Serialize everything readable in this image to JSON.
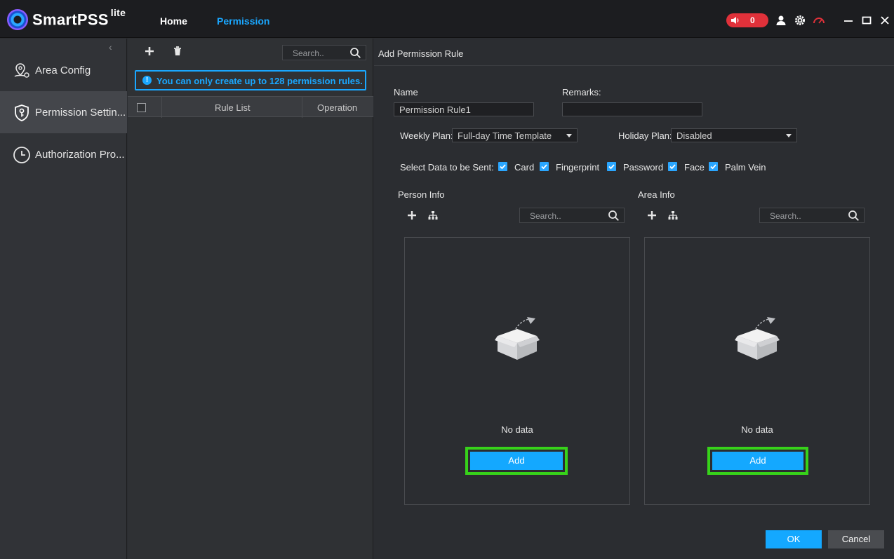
{
  "app": {
    "brand": "SmartPSS",
    "brand_suffix": "lite"
  },
  "nav": {
    "tabs": [
      {
        "label": "Home"
      },
      {
        "label": "Permission"
      }
    ]
  },
  "topbar": {
    "alarm_count": "0"
  },
  "sidebar": {
    "items": [
      {
        "label": "Area Config",
        "icon": "area-config-icon"
      },
      {
        "label": "Permission Settin...",
        "icon": "shield-key-icon"
      },
      {
        "label": "Authorization Pro...",
        "icon": "clock-icon"
      }
    ]
  },
  "rule_panel": {
    "search_placeholder": "Search..",
    "notice": "You can only create up to 128 permission rules.",
    "columns": {
      "rule_list": "Rule List",
      "operation": "Operation"
    }
  },
  "form": {
    "title": "Add Permission Rule",
    "name_label": "Name",
    "name_value": "Permission Rule1",
    "remarks_label": "Remarks:",
    "remarks_value": "",
    "weekly_plan_label": "Weekly Plan:",
    "weekly_plan_value": "Full-day Time Template",
    "holiday_plan_label": "Holiday Plan:",
    "holiday_plan_value": "Disabled",
    "data_sent_label": "Select Data to be Sent:",
    "data_types": [
      {
        "label": "Card",
        "checked": true
      },
      {
        "label": "Fingerprint",
        "checked": true
      },
      {
        "label": "Password",
        "checked": true
      },
      {
        "label": "Face",
        "checked": true
      },
      {
        "label": "Palm Vein",
        "checked": true
      }
    ],
    "person_info": {
      "title": "Person Info",
      "search_placeholder": "Search..",
      "empty_text": "No data",
      "add_label": "Add"
    },
    "area_info": {
      "title": "Area Info",
      "search_placeholder": "Search..",
      "empty_text": "No data",
      "add_label": "Add"
    },
    "ok_label": "OK",
    "cancel_label": "Cancel"
  },
  "colors": {
    "accent": "#14a8ff",
    "highlight": "#37d21a",
    "alarm": "#e0313a"
  }
}
